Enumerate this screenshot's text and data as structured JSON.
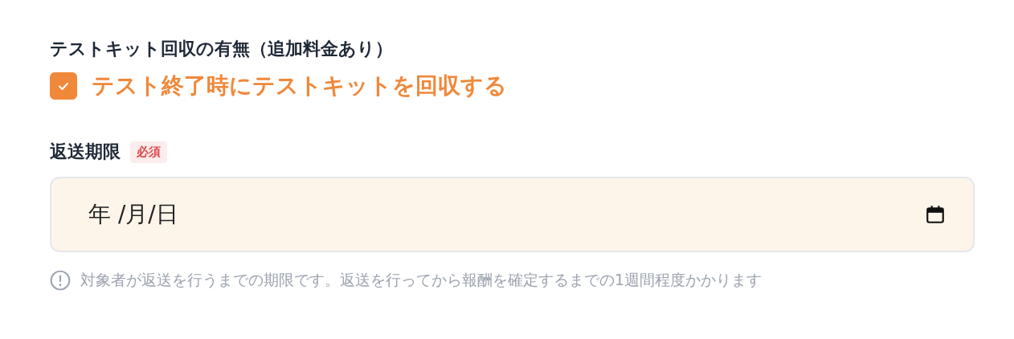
{
  "kit_return": {
    "label": "テストキット回収の有無（追加料金あり）",
    "option": {
      "label": "テスト終了時にテストキットを回収する",
      "checked": true
    }
  },
  "deadline": {
    "label": "返送期限",
    "badge": "必須",
    "placeholder": "年 /月/日",
    "help": "対象者が返送を行うまでの期限です。返送を行ってから報酬を確定するまでの1週間程度かかります"
  }
}
